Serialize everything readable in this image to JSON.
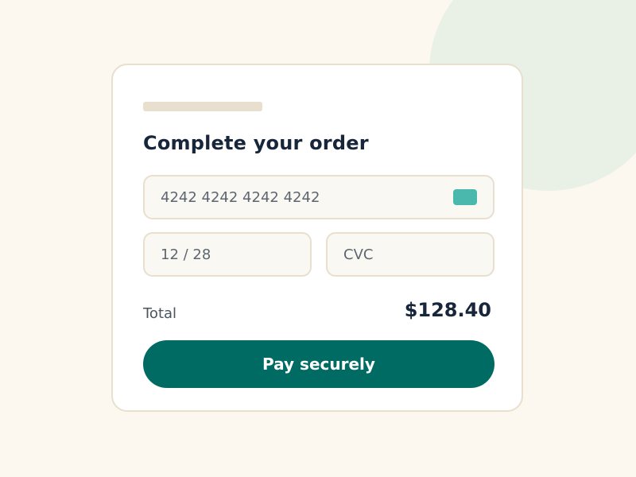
{
  "checkout": {
    "title": "Complete your order",
    "card_number": {
      "value": "4242 4242 4242 4242",
      "placeholder": "",
      "icon": "credit-card-icon",
      "icon_color": "#4bb8ad"
    },
    "expiry": {
      "value": "12 / 28",
      "placeholder": ""
    },
    "cvc": {
      "value": "",
      "placeholder": "CVC"
    },
    "total_label": "Total",
    "total_value": "$128.40",
    "pay_label": "Pay securely"
  },
  "colors": {
    "accent": "#006b63",
    "background": "#fcf7ef",
    "card_border": "#e8dfcf",
    "text_primary": "#17263a"
  }
}
